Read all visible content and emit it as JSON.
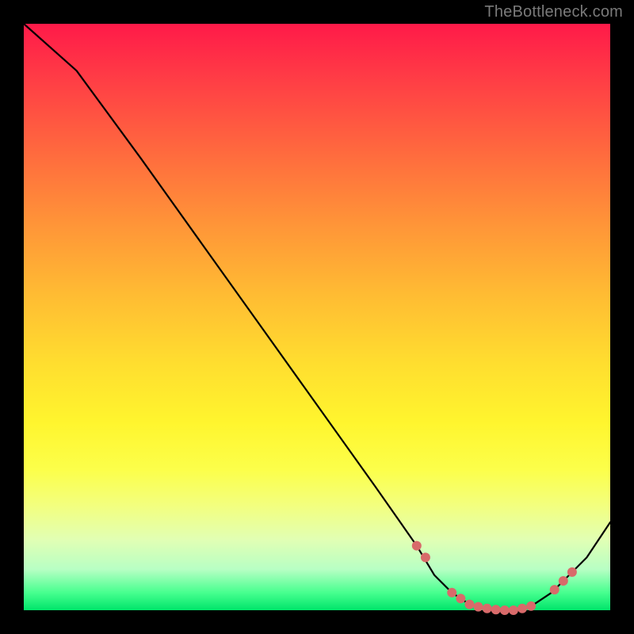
{
  "watermark": "TheBottleneck.com",
  "chart_data": {
    "type": "line",
    "title": "",
    "xlabel": "",
    "ylabel": "",
    "xlim": [
      0,
      100
    ],
    "ylim": [
      0,
      100
    ],
    "grid": false,
    "series": [
      {
        "name": "curve",
        "x": [
          0,
          9,
          20,
          30,
          40,
          50,
          60,
          67,
          70,
          73,
          76,
          80,
          84,
          87,
          90,
          93,
          96,
          100
        ],
        "y": [
          100,
          92,
          77,
          63,
          49,
          35,
          21,
          11,
          6,
          3,
          1,
          0,
          0,
          1,
          3,
          6,
          9,
          15
        ]
      }
    ],
    "markers": {
      "name": "highlighted-points",
      "x": [
        67,
        68.5,
        73,
        74.5,
        76,
        77.5,
        79,
        80.5,
        82,
        83.5,
        85,
        86.5,
        90.5,
        92,
        93.5
      ],
      "y": [
        11,
        9,
        3,
        2,
        1,
        0.6,
        0.3,
        0.1,
        0,
        0,
        0.3,
        0.7,
        3.5,
        5,
        6.5
      ]
    },
    "gradient_stops": [
      {
        "pos": 0,
        "color": "#ff1a49"
      },
      {
        "pos": 10,
        "color": "#ff3f45"
      },
      {
        "pos": 22,
        "color": "#ff6a3e"
      },
      {
        "pos": 34,
        "color": "#ff9438"
      },
      {
        "pos": 46,
        "color": "#ffbb33"
      },
      {
        "pos": 58,
        "color": "#ffde2f"
      },
      {
        "pos": 68,
        "color": "#fff52e"
      },
      {
        "pos": 76,
        "color": "#fcff4a"
      },
      {
        "pos": 82,
        "color": "#f3ff7d"
      },
      {
        "pos": 88,
        "color": "#e1ffb4"
      },
      {
        "pos": 93,
        "color": "#b8ffc4"
      },
      {
        "pos": 97,
        "color": "#47ff8f"
      },
      {
        "pos": 100,
        "color": "#00e56a"
      }
    ]
  }
}
